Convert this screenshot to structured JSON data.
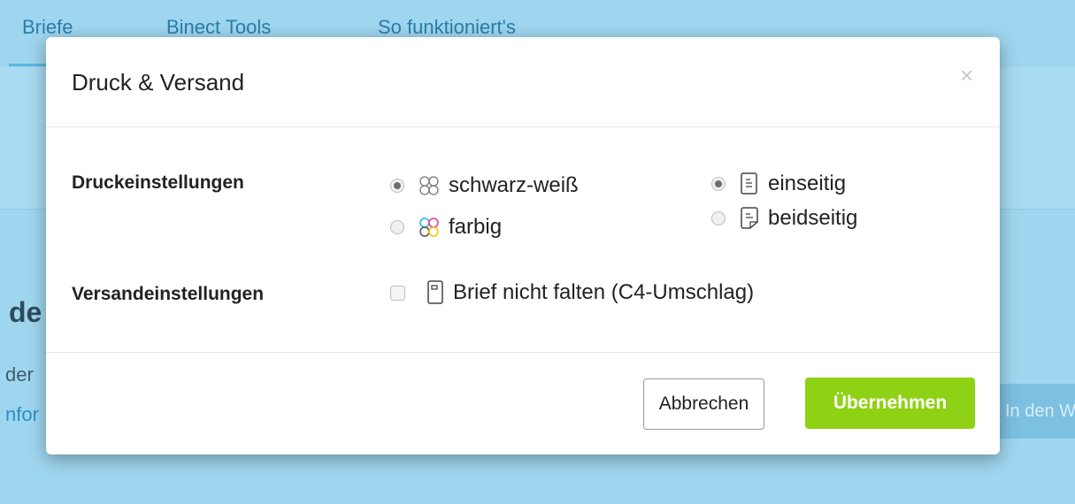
{
  "nav": {
    "items": [
      "Briefe",
      "Binect Tools",
      "So funktioniert's"
    ]
  },
  "background": {
    "heading_fragment": "de",
    "text_fragment": "der",
    "link_fragment": "nfor",
    "button_fragment": "In den W"
  },
  "modal": {
    "title": "Druck & Versand",
    "close_glyph": "×",
    "print_settings": {
      "label": "Druckeinstellungen",
      "color_options": [
        {
          "label": "schwarz-weiß",
          "checked": true,
          "icon": "grayscale-circles-icon"
        },
        {
          "label": "farbig",
          "checked": false,
          "icon": "color-circles-icon"
        }
      ],
      "side_options": [
        {
          "label": "einseitig",
          "checked": true,
          "icon": "single-sided-page-icon"
        },
        {
          "label": "beidseitig",
          "checked": false,
          "icon": "double-sided-page-icon"
        }
      ]
    },
    "shipping_settings": {
      "label": "Versandeinstellungen",
      "no_fold": {
        "label": "Brief nicht falten (C4-Umschlag)",
        "checked": false,
        "icon": "envelope-c4-icon"
      }
    },
    "buttons": {
      "cancel": "Abbrechen",
      "apply": "Übernehmen"
    }
  },
  "colors": {
    "accent_green": "#8fd114",
    "background_blue": "#9fd6ef",
    "nav_link": "#2a7ea8"
  }
}
